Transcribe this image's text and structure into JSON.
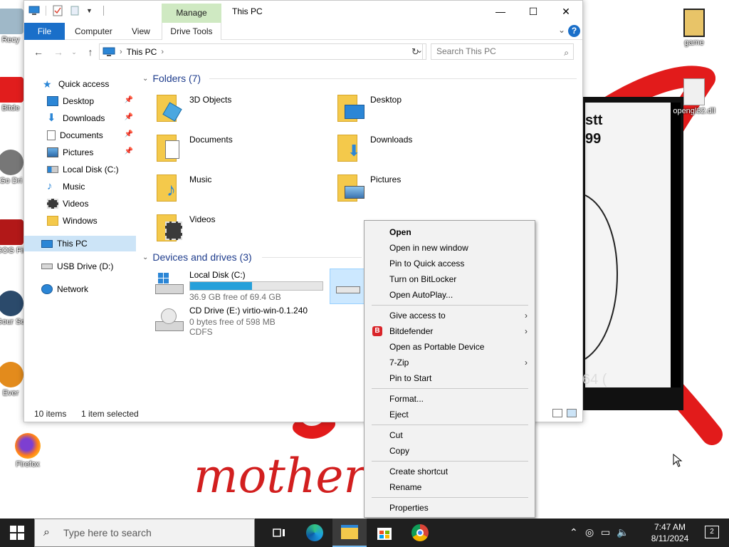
{
  "desktop": {
    "icons_left": [
      {
        "label": "Recy"
      },
      {
        "label": "Bitde"
      },
      {
        "label": "Go Dri"
      },
      {
        "label": "GOG Fir"
      },
      {
        "label": "Gour So"
      },
      {
        "label": "Ever"
      },
      {
        "label": "Firefox"
      }
    ],
    "icons_right": [
      {
        "label": "game"
      },
      {
        "label": "opengl32.dll"
      }
    ],
    "wallpaper_text": "mother",
    "bg_window_text": {
      "line1": "stt",
      "line2": "99",
      "line3": "64 ("
    }
  },
  "window": {
    "title": "This PC",
    "manage_label": "Manage",
    "controls": {
      "minimize": "—",
      "maximize": "☐",
      "close": "✕"
    }
  },
  "ribbon": {
    "tabs": [
      "File",
      "Computer",
      "View"
    ],
    "drive_tools": "Drive Tools",
    "help": "?"
  },
  "address": {
    "crumb": "This PC",
    "search_placeholder": "Search This PC"
  },
  "nav": {
    "quick_access": "Quick access",
    "items": [
      {
        "label": "Desktop",
        "pinned": true
      },
      {
        "label": "Downloads",
        "pinned": true
      },
      {
        "label": "Documents",
        "pinned": true
      },
      {
        "label": "Pictures",
        "pinned": true
      },
      {
        "label": "Local Disk (C:)",
        "pinned": false
      },
      {
        "label": "Music",
        "pinned": false
      },
      {
        "label": "Videos",
        "pinned": false
      },
      {
        "label": "Windows",
        "pinned": false
      }
    ],
    "this_pc": "This PC",
    "usb": "USB Drive (D:)",
    "network": "Network"
  },
  "content": {
    "folders_header": "Folders (7)",
    "folders": [
      "3D Objects",
      "Desktop",
      "Documents",
      "Downloads",
      "Music",
      "Pictures",
      "Videos"
    ],
    "drives_header": "Devices and drives (3)",
    "drives": [
      {
        "name": "Local Disk (C:)",
        "free": "36.9 GB free of 69.4 GB",
        "used_fraction": 0.47
      },
      {
        "name": "CD Drive (E:) virtio-win-0.1.240",
        "free": "0 bytes free of 598 MB",
        "fs": "CDFS"
      }
    ]
  },
  "status": {
    "items": "10 items",
    "selected": "1 item selected"
  },
  "context_menu": {
    "items": [
      "Open",
      "Open in new window",
      "Pin to Quick access",
      "Turn on BitLocker",
      "Open AutoPlay...",
      "Give access to",
      "Bitdefender",
      "Open as Portable Device",
      "7-Zip",
      "Pin to Start",
      "Format...",
      "Eject",
      "Cut",
      "Copy",
      "Create shortcut",
      "Rename",
      "Properties"
    ],
    "bitdefender_badge": "B"
  },
  "taskbar": {
    "search_placeholder": "Type here to search",
    "time": "7:47 AM",
    "date": "8/11/2024",
    "notifications": "2"
  },
  "colors": {
    "accent": "#1a6fc9",
    "selection": "#cce4f7",
    "progress": "#26a0da",
    "manage_tab": "#cfe9c2",
    "taskbar": "#1f1f1f"
  }
}
